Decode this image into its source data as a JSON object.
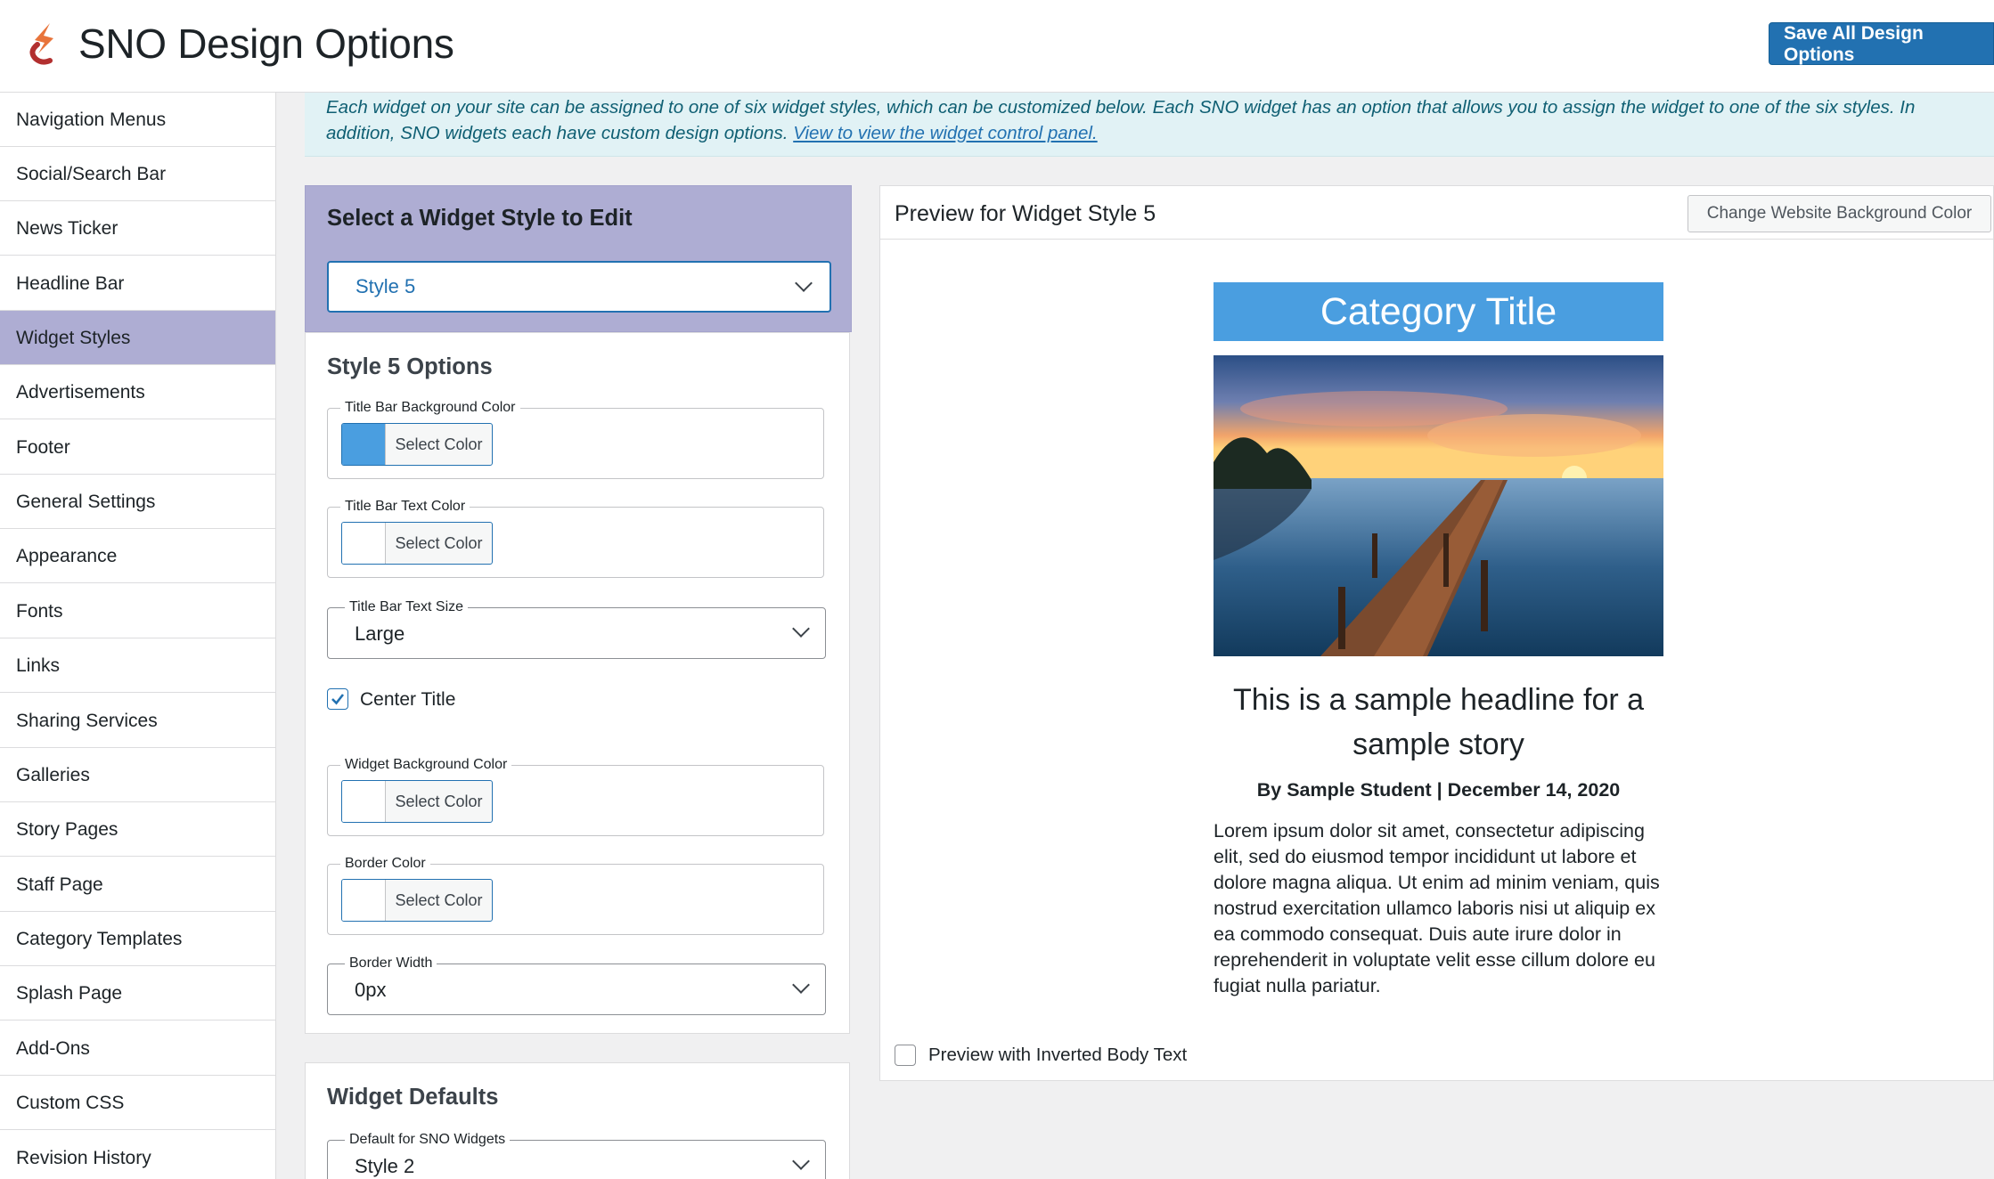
{
  "header": {
    "title": "SNO Design Options",
    "save_label": "Save All Design Options",
    "accent_color": "#2271b1"
  },
  "sidebar": {
    "items": [
      {
        "label": "Navigation Menus"
      },
      {
        "label": "Social/Search Bar"
      },
      {
        "label": "News Ticker"
      },
      {
        "label": "Headline Bar"
      },
      {
        "label": "Widget Styles",
        "active": true
      },
      {
        "label": "Advertisements"
      },
      {
        "label": "Footer"
      },
      {
        "label": "General Settings"
      },
      {
        "label": "Appearance"
      },
      {
        "label": "Fonts"
      },
      {
        "label": "Links"
      },
      {
        "label": "Sharing Services"
      },
      {
        "label": "Galleries"
      },
      {
        "label": "Story Pages"
      },
      {
        "label": "Staff Page"
      },
      {
        "label": "Category Templates"
      },
      {
        "label": "Splash Page"
      },
      {
        "label": "Add-Ons"
      },
      {
        "label": "Custom CSS"
      },
      {
        "label": "Revision History"
      }
    ],
    "active_color": "#aeadd3"
  },
  "notice": {
    "text": "Each widget on your site can be assigned to one of six widget styles, which can be customized below. Each SNO widget has an option that allows you to assign the widget to one of the six styles. In addition, SNO widgets each have custom design options.",
    "link": "View to view the widget control panel."
  },
  "style_select": {
    "heading": "Select a Widget Style to Edit",
    "value": "Style 5"
  },
  "options": {
    "heading": "Style 5 Options",
    "title_bar_bg": {
      "legend": "Title Bar Background Color",
      "button": "Select Color",
      "swatch": "#4a9ee0"
    },
    "title_bar_text": {
      "legend": "Title Bar Text Color",
      "button": "Select Color",
      "swatch": "#ffffff"
    },
    "title_bar_size": {
      "legend": "Title Bar Text Size",
      "value": "Large"
    },
    "center_title": {
      "label": "Center Title",
      "checked": true
    },
    "widget_bg": {
      "legend": "Widget Background Color",
      "button": "Select Color",
      "swatch": "#ffffff"
    },
    "border_color": {
      "legend": "Border Color",
      "button": "Select Color",
      "swatch": "#ffffff"
    },
    "border_width": {
      "legend": "Border Width",
      "value": "0px"
    }
  },
  "defaults": {
    "heading": "Widget Defaults",
    "sno_widgets": {
      "legend": "Default for SNO Widgets",
      "value": "Style 2"
    }
  },
  "preview": {
    "title": "Preview for Widget Style 5",
    "bg_button": "Change Website Background Color",
    "category_title": "Category Title",
    "headline": "This is a sample headline for a sample story",
    "byline": "By Sample Student | December 14, 2020",
    "body": "Lorem ipsum dolor sit amet, consectetur adipiscing elit, sed do eiusmod tempor incididunt ut labore et dolore magna aliqua. Ut enim ad minim veniam, quis nostrud exercitation ullamco laboris nisi ut aliquip ex ea commodo consequat. Duis aute irure dolor in reprehenderit in voluptate velit esse cillum dolore eu fugiat nulla pariatur.",
    "inverted": {
      "label": "Preview with Inverted Body Text",
      "checked": false
    }
  }
}
